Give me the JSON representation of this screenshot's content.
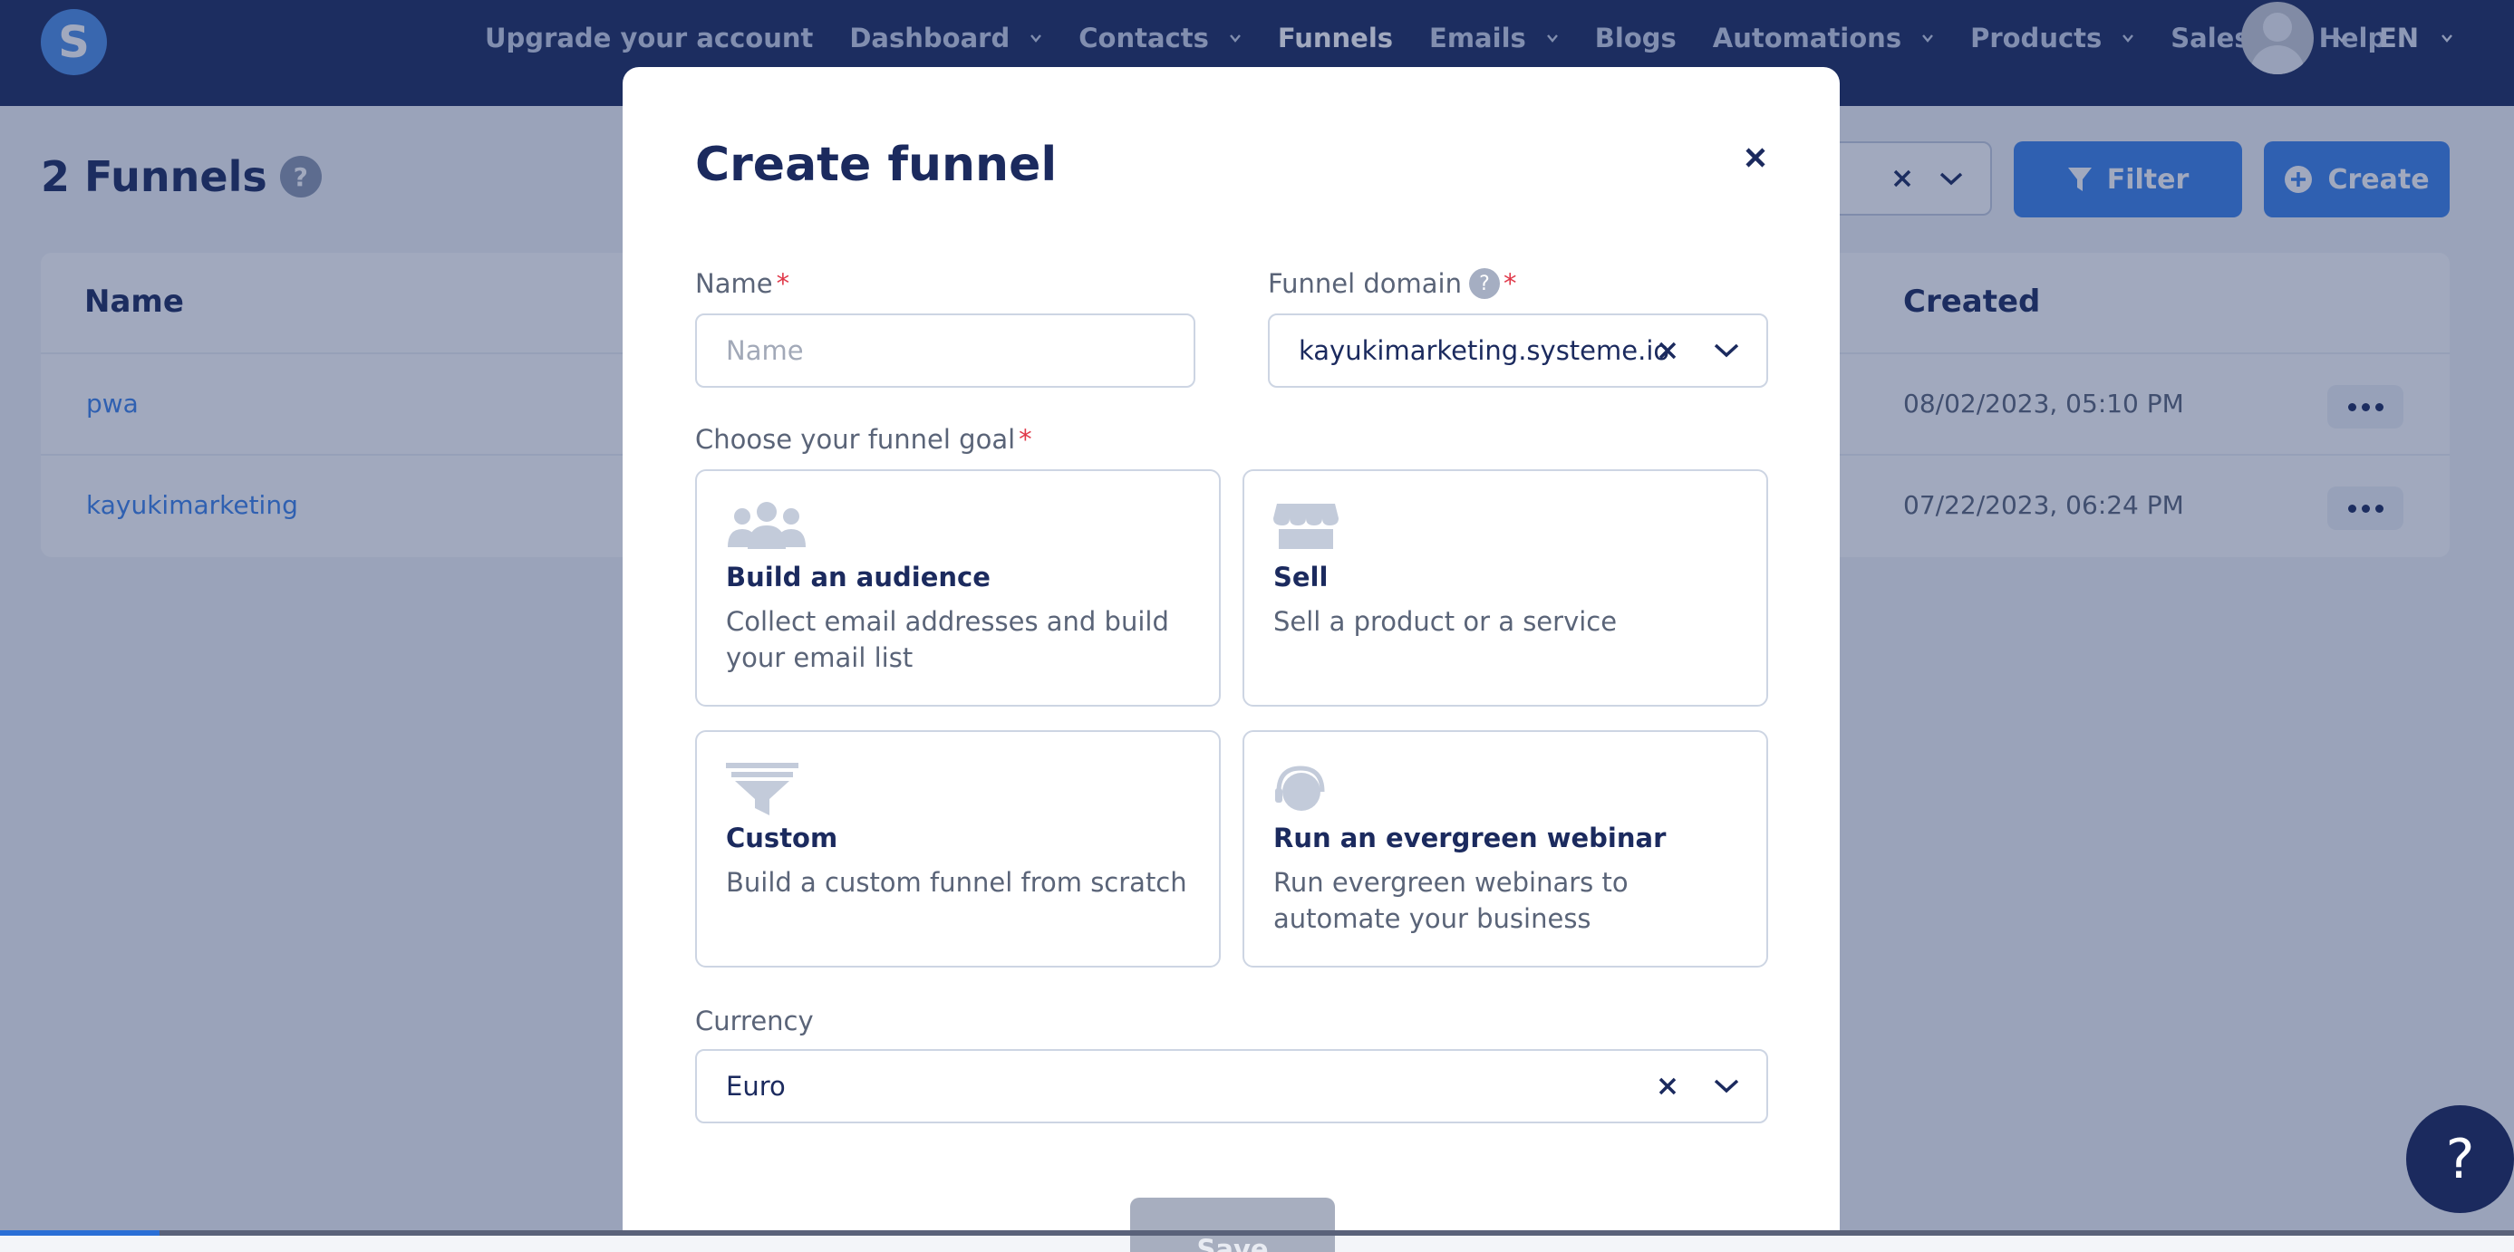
{
  "nav": {
    "logo_letter": "S",
    "items": [
      {
        "label": "Upgrade your account",
        "has_chevron": false,
        "active": false
      },
      {
        "label": "Dashboard",
        "has_chevron": true,
        "active": false
      },
      {
        "label": "Contacts",
        "has_chevron": true,
        "active": false
      },
      {
        "label": "Funnels",
        "has_chevron": false,
        "active": true
      },
      {
        "label": "Emails",
        "has_chevron": true,
        "active": false
      },
      {
        "label": "Blogs",
        "has_chevron": false,
        "active": false
      },
      {
        "label": "Automations",
        "has_chevron": true,
        "active": false
      },
      {
        "label": "Products",
        "has_chevron": true,
        "active": false
      },
      {
        "label": "Sales",
        "has_chevron": true,
        "active": false
      },
      {
        "label": "Help",
        "has_chevron": false,
        "active": false
      }
    ],
    "language": "EN"
  },
  "page": {
    "title": "2 Funnels",
    "help_icon_text": "?",
    "filter_button": "Filter",
    "create_button": "Create",
    "table": {
      "headers": {
        "name": "Name",
        "created": "Created"
      },
      "rows": [
        {
          "name": "pwa",
          "created": "08/02/2023, 05:10 PM"
        },
        {
          "name": "kayukimarketing",
          "created": "07/22/2023, 06:24 PM"
        }
      ]
    }
  },
  "modal": {
    "title": "Create funnel",
    "name_label": "Name",
    "name_placeholder": "Name",
    "name_value": "",
    "domain_label": "Funnel domain",
    "domain_value": "kayukimarketing.systeme.io",
    "required_mark": "*",
    "goal_label": "Choose your funnel goal",
    "goals": [
      {
        "title": "Build an audience",
        "desc": "Collect email addresses and build your email list",
        "icon": "audience-icon"
      },
      {
        "title": "Sell",
        "desc": "Sell a product or a service",
        "icon": "store-icon"
      },
      {
        "title": "Custom",
        "desc": "Build a custom funnel from scratch",
        "icon": "funnel-icon"
      },
      {
        "title": "Run an evergreen webinar",
        "desc": "Run evergreen webinars to automate your business",
        "icon": "headset-icon"
      }
    ],
    "currency_label": "Currency",
    "currency_value": "Euro",
    "save_button": "Save"
  },
  "chat_button_text": "?",
  "colors": {
    "nav_bg": "#1b2a5e",
    "accent": "#3b82e8",
    "required": "#e0394a",
    "title": "#1b2a5e"
  }
}
